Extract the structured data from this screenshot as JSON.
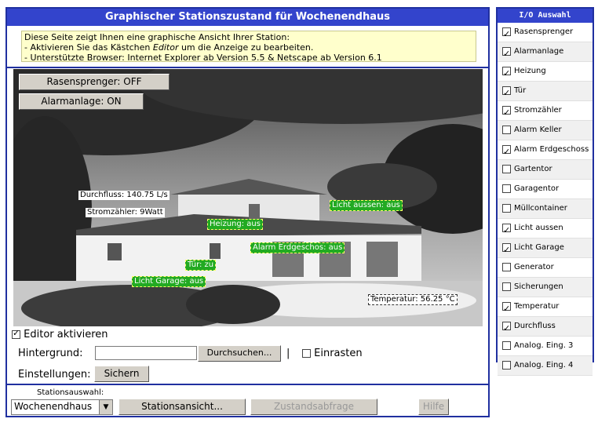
{
  "title": "Graphischer Stationszustand für Wochenendhaus",
  "info": {
    "line1": "Diese Seite zeigt Ihnen eine graphische Ansicht Ihrer Station:",
    "line2_pre": "- Aktivieren Sie das Kästchen ",
    "line2_em": "Editor",
    "line2_post": " um die Anzeige zu bearbeiten.",
    "line3": "- Unterstützte Browser: Internet Explorer ab Version 5.5 & Netscape ab Version 6.1"
  },
  "scene": {
    "btn_rasensprenger": "Rasensprenger: OFF",
    "btn_alarmanlage": "Alarmanlage: ON",
    "tag_durchfluss": "Durchfluss: 140.75 L/s",
    "tag_stromzaehler": "Stromzähler: 9Watt",
    "tag_licht_aussen": "Licht aussen: aus",
    "tag_heizung": "Heizung: aus",
    "tag_alarm_erdgeschoss": "Alarm Erdgeschos: aus",
    "tag_tuer": "Tür: zu",
    "tag_licht_garage": "Licht Garage: aus",
    "tag_temperatur": "Temperatur: 56.25 °C"
  },
  "editor": {
    "activate_label": "Editor aktivieren",
    "background_label": "Hintergrund:",
    "background_value": "",
    "browse_label": "Durchsuchen...",
    "separator": "|",
    "snap_label": "Einrasten",
    "settings_label": "Einstellungen:",
    "save_label": "Sichern"
  },
  "footer": {
    "station_label": "Stationsauswahl:",
    "station_value": "Wochenendhaus",
    "station_view": "Stationsansicht...",
    "status_query": "Zustandsabfrage",
    "help": "Hilfe"
  },
  "io": {
    "title": "I/O Auswahl",
    "items": [
      {
        "label": "Rasensprenger",
        "checked": true
      },
      {
        "label": "Alarmanlage",
        "checked": true
      },
      {
        "label": "Heizung",
        "checked": true
      },
      {
        "label": "Tür",
        "checked": true
      },
      {
        "label": "Stromzähler",
        "checked": true
      },
      {
        "label": "Alarm Keller",
        "checked": false
      },
      {
        "label": "Alarm Erdgeschoss",
        "checked": true
      },
      {
        "label": "Gartentor",
        "checked": false
      },
      {
        "label": "Garagentor",
        "checked": false
      },
      {
        "label": "Müllcontainer",
        "checked": false
      },
      {
        "label": "Licht aussen",
        "checked": true
      },
      {
        "label": "Licht Garage",
        "checked": true
      },
      {
        "label": "Generator",
        "checked": false
      },
      {
        "label": "Sicherungen",
        "checked": false
      },
      {
        "label": "Temperatur",
        "checked": true
      },
      {
        "label": "Durchfluss",
        "checked": true
      },
      {
        "label": "Analog. Eing. 3",
        "checked": false
      },
      {
        "label": "Analog. Eing. 4",
        "checked": false
      }
    ]
  },
  "colors": {
    "accent": "#3344cc",
    "tag_green": "#22aa22",
    "info_bg": "#ffffcc"
  }
}
